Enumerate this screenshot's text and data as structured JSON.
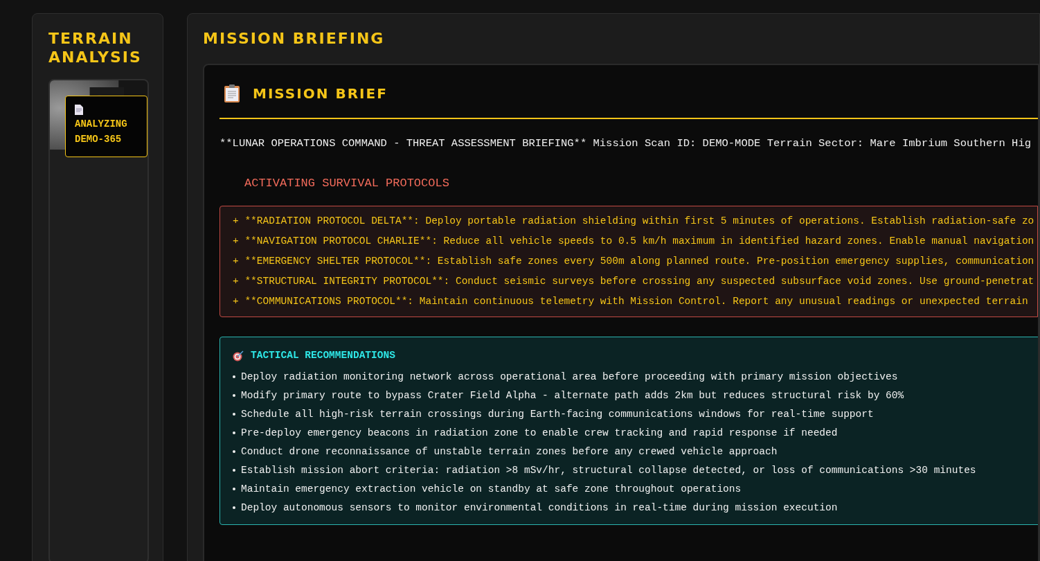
{
  "sidebar": {
    "title": "TERRAIN ANALYSIS",
    "thumbnail": {
      "kind": "picture",
      "status": "ANALYZING DEMO-365"
    }
  },
  "main": {
    "title": "MISSION BRIEFING",
    "brief": {
      "title": "MISSION BRIEF",
      "summary": "**LUNAR OPERATIONS COMMAND - THREAT ASSESSMENT BRIEFING** Mission Scan ID: DEMO-MODE Terrain Sector: Mare Imbrium Southern Hig",
      "alert_heading": "ACTIVATING SURVIVAL PROTOCOLS",
      "protocols": [
        "+ **RADIATION PROTOCOL DELTA**: Deploy portable radiation shielding within first 5 minutes of operations. Establish radiation-safe zo",
        "+ **NAVIGATION PROTOCOL CHARLIE**: Reduce all vehicle speeds to 0.5 km/h maximum in identified hazard zones. Enable manual navigation",
        "+ **EMERGENCY SHELTER PROTOCOL**: Establish safe zones every 500m along planned route. Pre-position emergency supplies, communication",
        "+ **STRUCTURAL INTEGRITY PROTOCOL**: Conduct seismic surveys before crossing any suspected subsurface void zones. Use ground-penetrat",
        "+ **COMMUNICATIONS PROTOCOL**: Maintain continuous telemetry with Mission Control. Report any unusual readings or unexpected terrain"
      ],
      "tactical": {
        "title": "TACTICAL RECOMMENDATIONS",
        "items": [
          "Deploy radiation monitoring network across operational area before proceeding with primary mission objectives",
          "Modify primary route to bypass Crater Field Alpha - alternate path adds 2km but reduces structural risk by 60%",
          "Schedule all high-risk terrain crossings during Earth-facing communications windows for real-time support",
          "Pre-deploy emergency beacons in radiation zone to enable crew tracking and rapid response if needed",
          "Conduct drone reconnaissance of unstable terrain zones before any crewed vehicle approach",
          "Establish mission abort criteria: radiation >8 mSv/hr, structural collapse detected, or loss of communications >30 minutes",
          "Maintain emergency extraction vehicle on standby at safe zone throughout operations",
          "Deploy autonomous sensors to monitor environmental conditions in real-time during mission execution"
        ]
      }
    }
  }
}
